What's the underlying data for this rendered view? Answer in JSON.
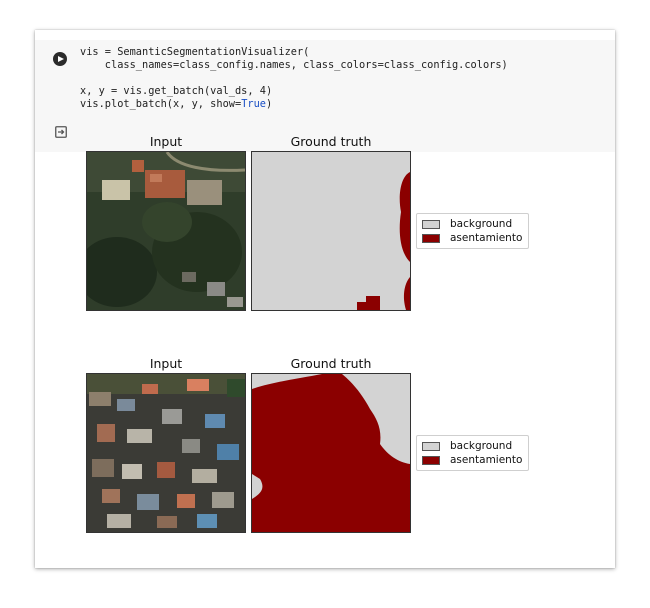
{
  "code": {
    "line1": "vis = SemanticSegmentationVisualizer(",
    "line2": "    class_names=class_config.names, class_colors=class_config.colors)",
    "line3": "",
    "line4": "x, y = vis.get_batch(val_ds, 4)",
    "line5_prefix": "vis.plot_batch(x, y, show=",
    "line5_kw": "True",
    "line5_suffix": ")"
  },
  "output": {
    "rows": [
      {
        "input_title": "Input",
        "truth_title": "Ground truth"
      },
      {
        "input_title": "Input",
        "truth_title": "Ground truth"
      }
    ],
    "legend": [
      {
        "label": "background",
        "color": "#d3d3d3"
      },
      {
        "label": "asentamiento",
        "color": "#8b0000"
      }
    ]
  },
  "colors": {
    "background": "#d3d3d3",
    "asentamiento": "#8b0000",
    "keyword": "#1a4fc4"
  }
}
